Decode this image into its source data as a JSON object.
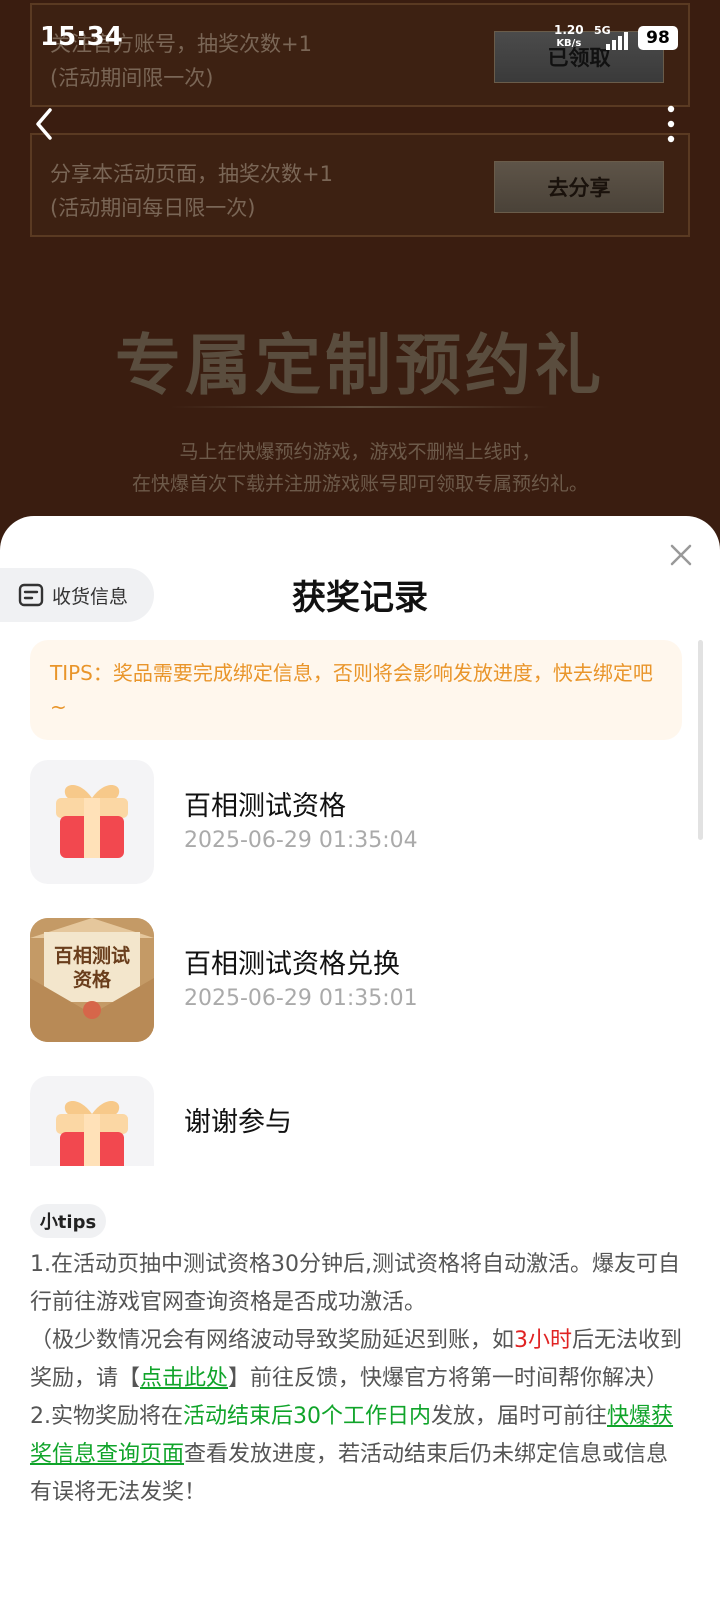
{
  "status_bar": {
    "time": "15:34",
    "net_speed_value": "1.20",
    "net_speed_unit": "KB/s",
    "network": "5G",
    "battery": "98"
  },
  "background": {
    "tasks": [
      {
        "line1": "关注官方账号，抽奖次数+1",
        "line2": "(活动期间限一次)",
        "button": "已领取"
      },
      {
        "line1": "分享本活动页面，抽奖次数+1",
        "line2": "(活动期间每日限一次)",
        "button": "去分享"
      }
    ],
    "section_title": "专属定制预约礼",
    "desc_line1": "马上在快爆预约游戏，游戏不删档上线时，",
    "desc_line2": "在快爆首次下载并注册游戏账号即可领取专属预约礼。"
  },
  "sheet": {
    "title": "获奖记录",
    "address_button": "收货信息",
    "tips": "TIPS：奖品需要完成绑定信息，否则将会影响发放进度，快去绑定吧~",
    "records": [
      {
        "name": "百相测试资格",
        "time": "2025-06-29 01:35:04",
        "icon": "gift-box-icon"
      },
      {
        "name": "百相测试资格兑换",
        "time": "2025-06-29 01:35:01",
        "icon": "envelope-card-icon",
        "card_text_1": "百相测试",
        "card_text_2": "资格"
      },
      {
        "name": "谢谢参与",
        "time": "",
        "icon": "gift-box-icon"
      }
    ],
    "small_tips_label": "小tips",
    "notes": {
      "p1": "1.在活动页抽中测试资格30分钟后,测试资格将自动激活。爆友可自行前往游戏官网查询资格是否成功激活。",
      "p2_a": "（极少数情况会有网络波动导致奖励延迟到账，如",
      "p2_red": "3小时",
      "p2_b": "后无法收到奖励，请【",
      "p2_link": "点击此处",
      "p2_c": "】前往反馈，快爆官方将第一时间帮你解决）",
      "p3_a": "2.实物奖励将在",
      "p3_green": "活动结束后30个工作日内",
      "p3_b": "发放，届时可前往",
      "p3_link": "快爆获奖信息查询页面",
      "p3_c": "查看发放进度，若活动结束后仍未绑定信息或信息有误将无法发奖！"
    }
  },
  "colors": {
    "tips_text": "#e9952a",
    "tips_bg": "#fff7ed",
    "highlight_red": "#e02323",
    "highlight_green": "#10a42a"
  }
}
